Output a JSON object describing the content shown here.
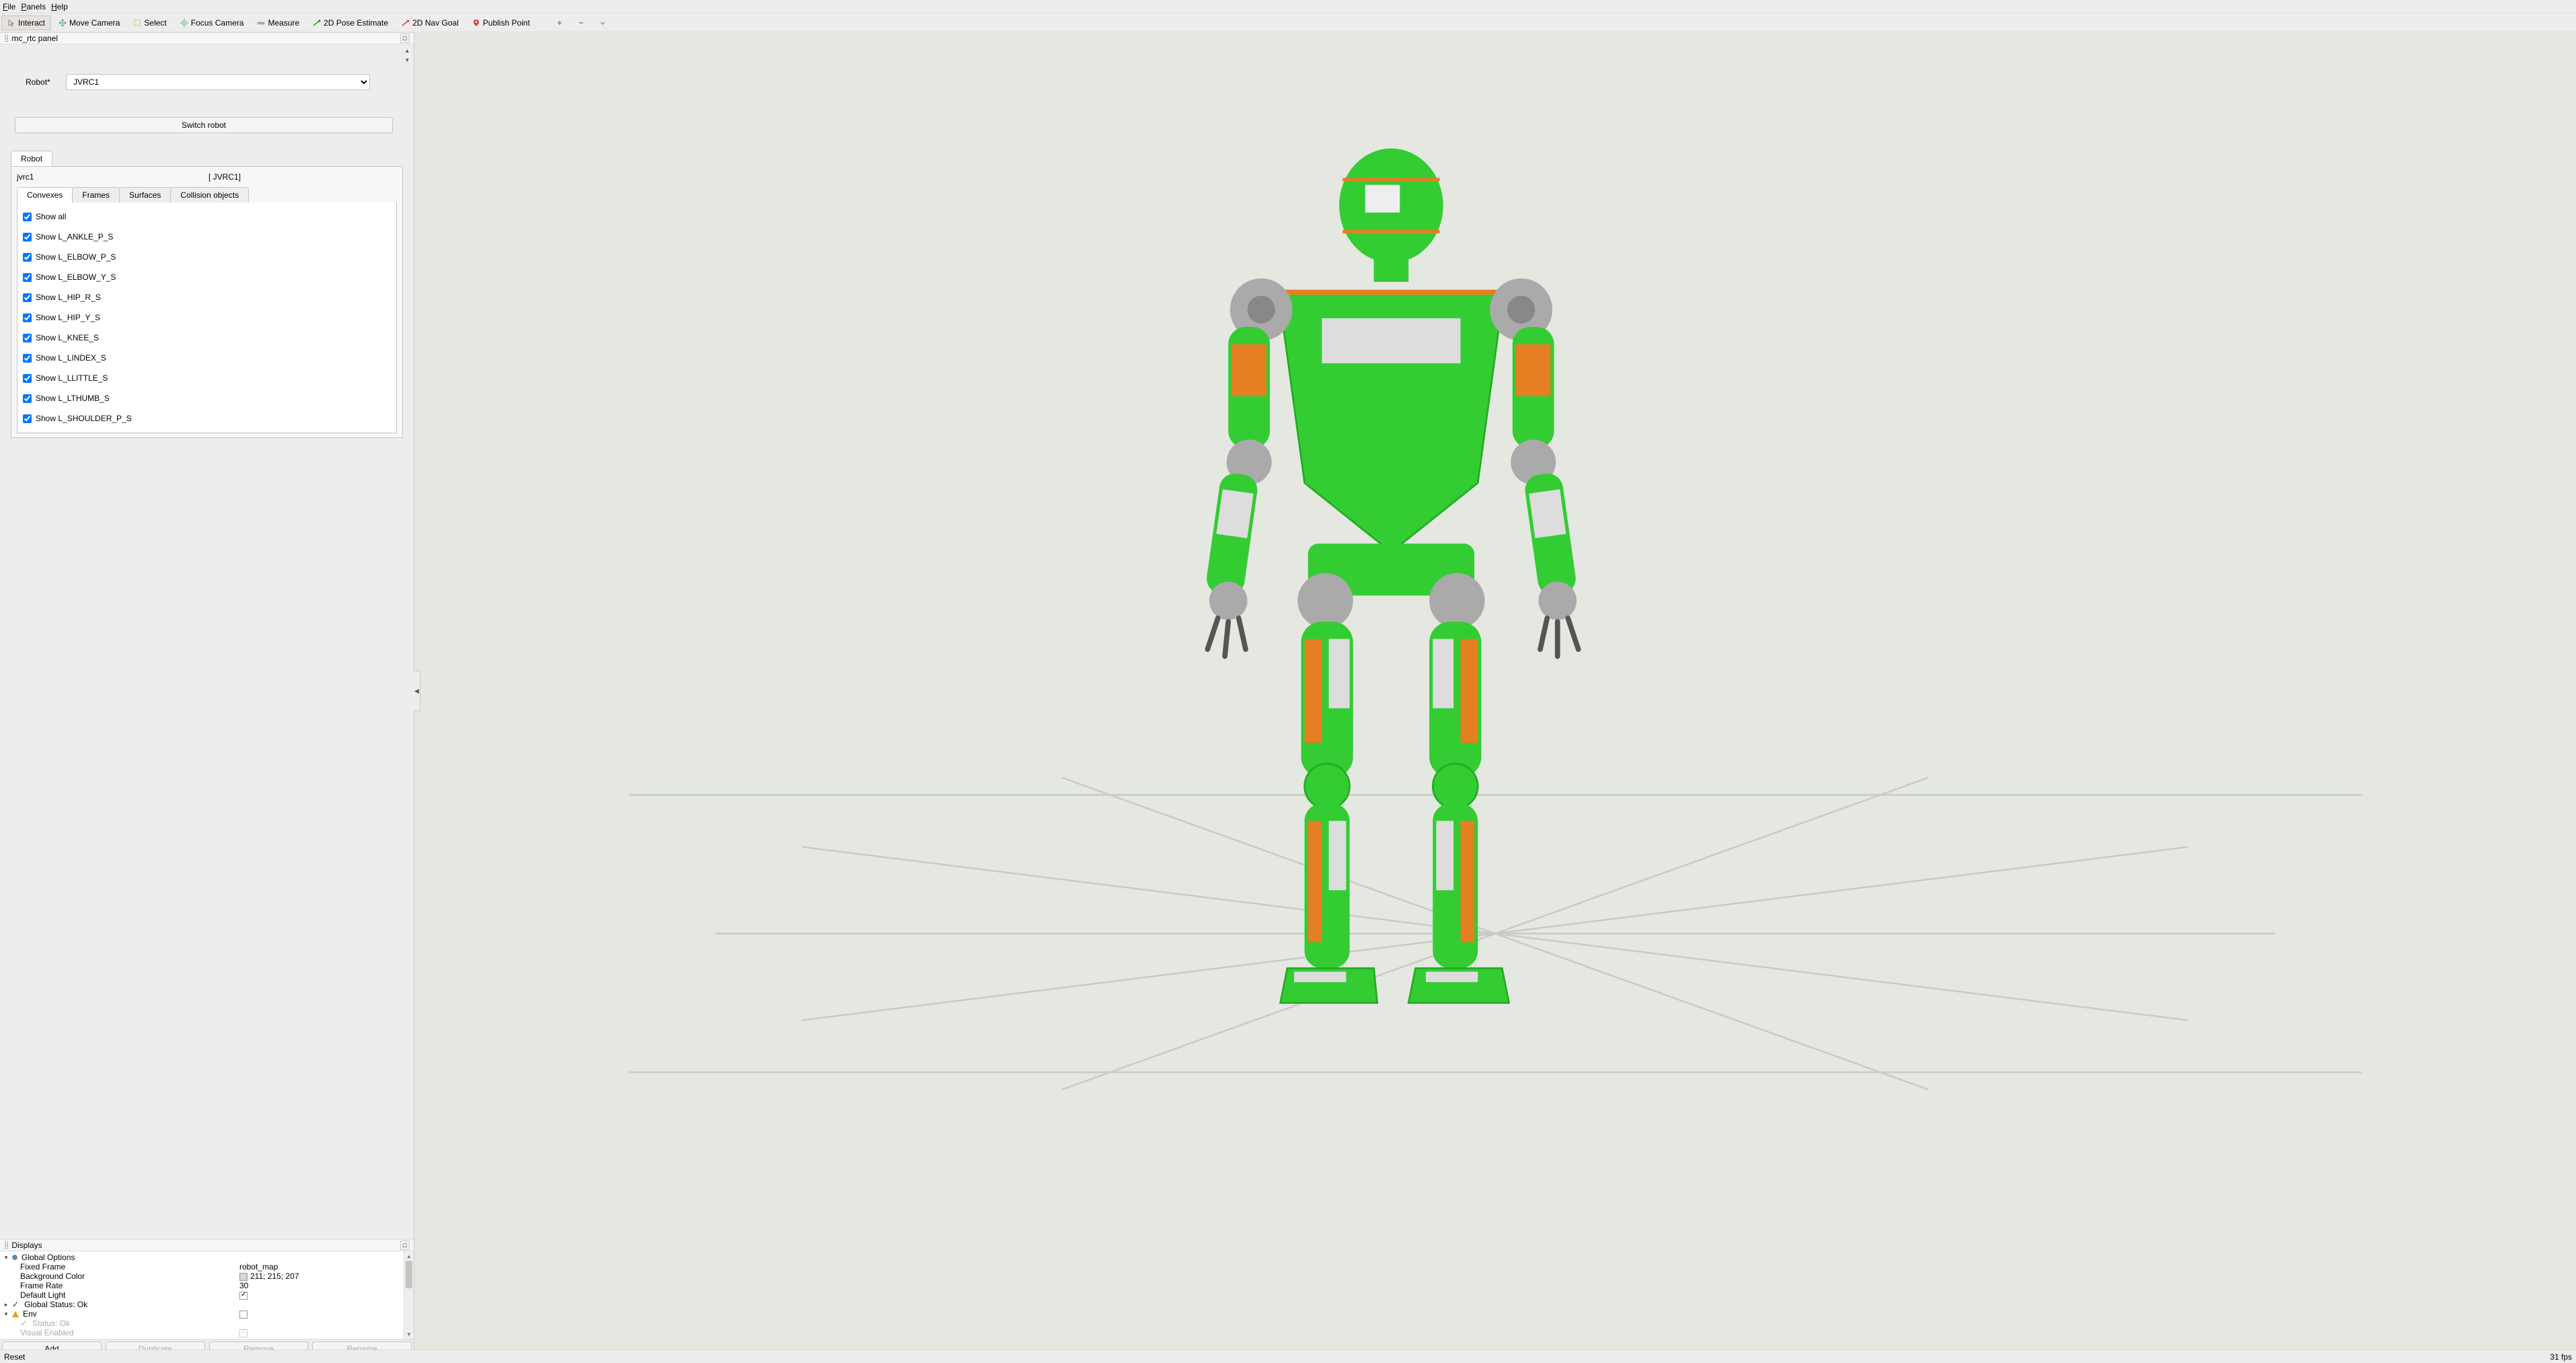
{
  "menu": {
    "file": "File",
    "panels": "Panels",
    "help": "Help"
  },
  "toolbar": {
    "interact": "Interact",
    "move_camera": "Move Camera",
    "select": "Select",
    "focus_camera": "Focus Camera",
    "measure": "Measure",
    "pose_estimate": "2D Pose Estimate",
    "nav_goal": "2D Nav Goal",
    "publish_point": "Publish Point"
  },
  "mcrtc": {
    "title": "mc_rtc panel",
    "robot_label": "Robot*",
    "robot_value": "JVRC1",
    "switch_btn": "Switch robot",
    "tab_robot": "Robot",
    "name_key": "jvrc1",
    "name_val": "[ JVRC1]",
    "subtabs": {
      "convexes": "Convexes",
      "frames": "Frames",
      "surfaces": "Surfaces",
      "collision": "Collision objects"
    },
    "checks": [
      "Show all",
      "Show L_ANKLE_P_S",
      "Show L_ELBOW_P_S",
      "Show L_ELBOW_Y_S",
      "Show L_HIP_R_S",
      "Show L_HIP_Y_S",
      "Show L_KNEE_S",
      "Show L_LINDEX_S",
      "Show L_LLITTLE_S",
      "Show L_LTHUMB_S",
      "Show L_SHOULDER_P_S"
    ]
  },
  "displays": {
    "title": "Displays",
    "global_options": "Global Options",
    "fixed_frame": "Fixed Frame",
    "fixed_frame_val": "robot_map",
    "bg_color": "Background Color",
    "bg_color_val": "211; 215; 207",
    "frame_rate": "Frame Rate",
    "frame_rate_val": "30",
    "default_light": "Default Light",
    "global_status": "Global Status: Ok",
    "env": "Env",
    "status_ok": "Status: Ok",
    "visual_enabled": "Visual Enabled",
    "btn_add": "Add",
    "btn_duplicate": "Duplicate",
    "btn_remove": "Remove",
    "btn_rename": "Rename"
  },
  "status": {
    "reset": "Reset",
    "fps": "31 fps"
  }
}
